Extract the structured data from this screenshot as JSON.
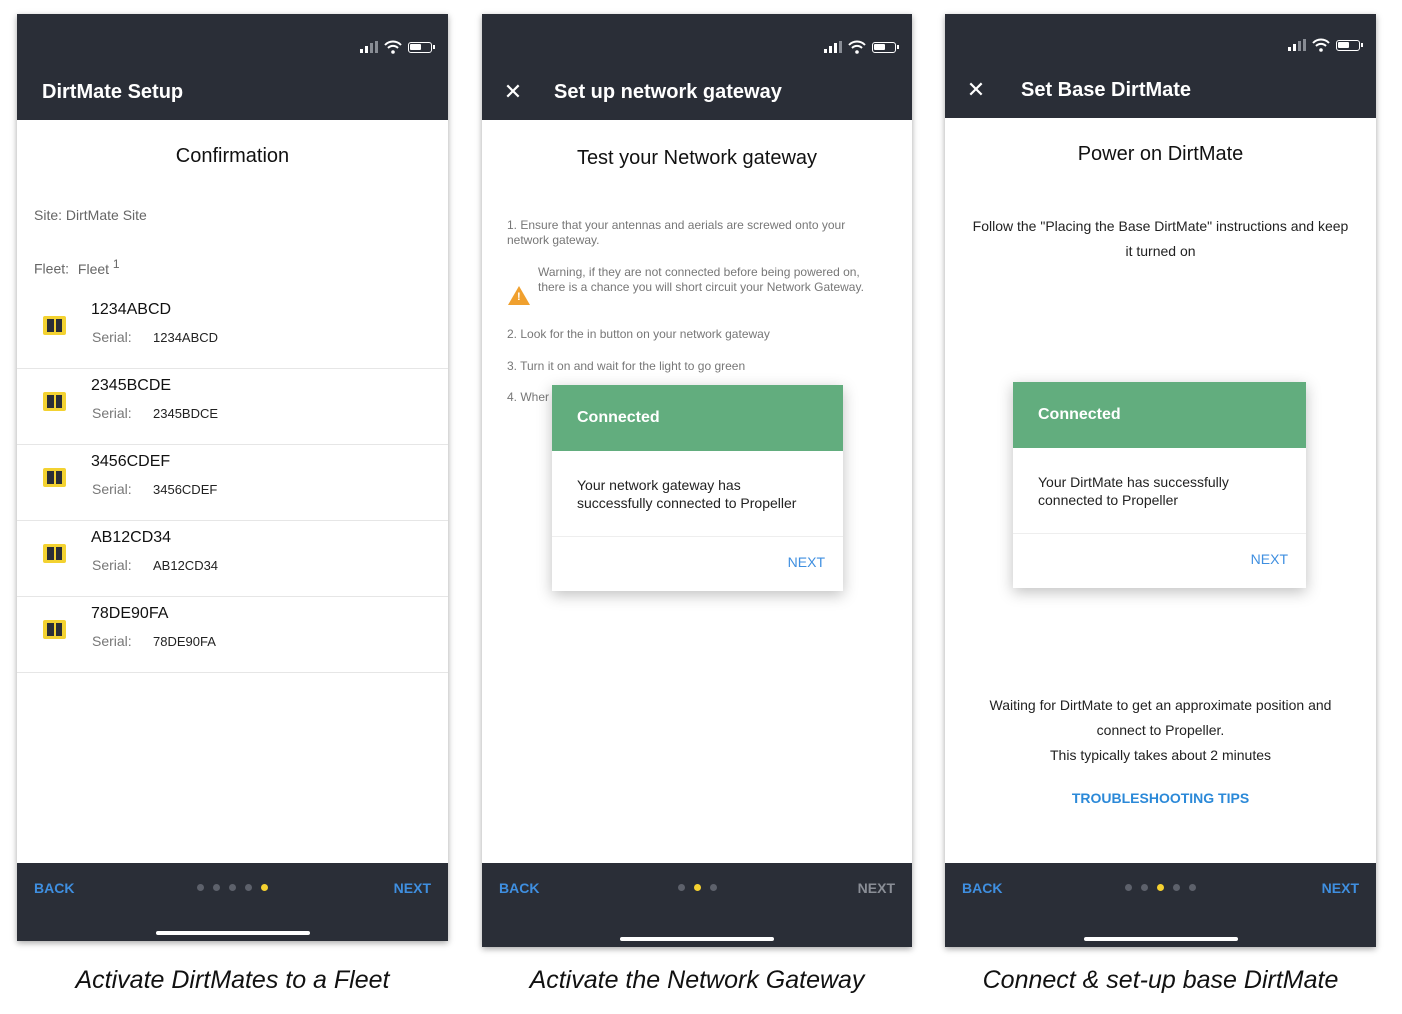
{
  "screens": [
    {
      "appbar_title": "DirtMate Setup",
      "title": "Confirmation",
      "site_line": "Site: DirtMate Site",
      "fleet_label": "Fleet:",
      "fleet_value": "Fleet",
      "fleet_suffix": "1",
      "serial_label": "Serial:",
      "devices": [
        {
          "name": "1234ABCD",
          "serial": "1234ABCD"
        },
        {
          "name": "2345BCDE",
          "serial": "2345BDCE"
        },
        {
          "name": "3456CDEF",
          "serial": "3456CDEF"
        },
        {
          "name": "AB12CD34",
          "serial": "AB12CD34"
        },
        {
          "name": "78DE90FA",
          "serial": "78DE90FA"
        }
      ],
      "back_label": "BACK",
      "next_label": "NEXT",
      "dots_total": 5,
      "dots_active": 5,
      "caption": "Activate DirtMates to a Fleet"
    },
    {
      "close_icon": "close-icon",
      "appbar_title": "Set up network gateway",
      "title": "Test your Network gateway",
      "steps": {
        "step1": "1. Ensure that your antennas and aerials are screwed onto your network gateway.",
        "warning": "Warning, if they are not connected before being powered on, there is a chance you will short circuit your Network Gateway.",
        "step2": "2. Look for the in button on your network gateway",
        "step3": "3. Turn it on and wait for the light to go green",
        "step4": "4. Wher"
      },
      "dialog": {
        "heading": "Connected",
        "message": "Your network gateway has successfully connected to Propeller",
        "next": "NEXT"
      },
      "back_label": "BACK",
      "next_label": "NEXT",
      "dots_total": 3,
      "dots_active": 2,
      "caption": "Activate the Network Gateway"
    },
    {
      "close_icon": "close-icon",
      "appbar_title": "Set Base DirtMate",
      "title": "Power on DirtMate",
      "instructions": "Follow the \"Placing the Base DirtMate\" instructions and keep it turned on",
      "dialog": {
        "heading": "Connected",
        "message": "Your DirtMate has successfully connected to Propeller",
        "next": "NEXT"
      },
      "waiting_line1": "Waiting for DirtMate to get an approximate position and connect to Propeller.",
      "waiting_line2": "This typically takes about 2 minutes",
      "troubleshooting": "TROUBLESHOOTING TIPS",
      "back_label": "BACK",
      "next_label": "NEXT",
      "dots_total": 5,
      "dots_active": 3,
      "caption": "Connect & set-up base DirtMate"
    }
  ],
  "colors": {
    "bar": "#2a2e37",
    "accent_blue": "#3f8fe0",
    "success_green": "#62ad7e",
    "dot_active": "#f5d130",
    "warning": "#f0a02e"
  }
}
